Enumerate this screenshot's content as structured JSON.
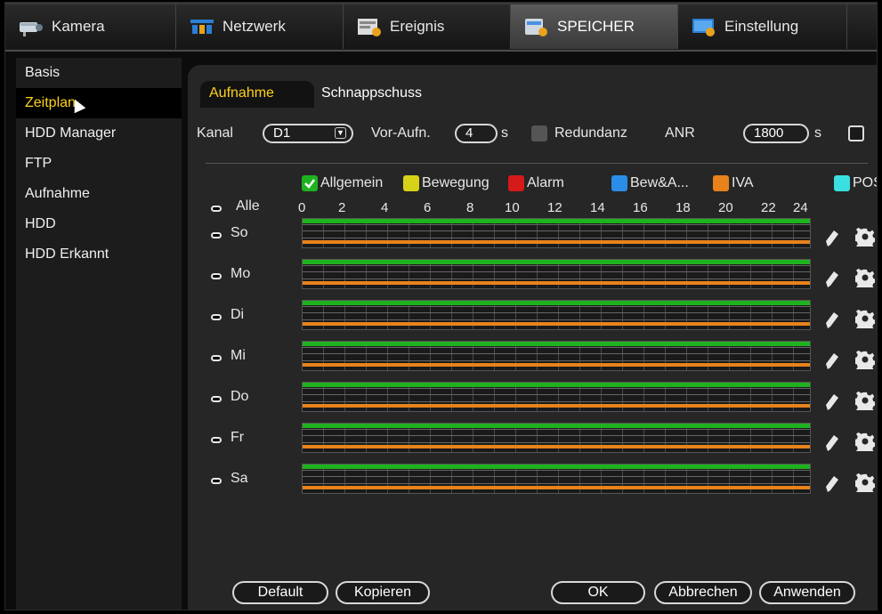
{
  "top_tabs": [
    {
      "label": "Kamera",
      "icon": "camera-icon"
    },
    {
      "label": "Netzwerk",
      "icon": "network-icon"
    },
    {
      "label": "Ereignis",
      "icon": "event-icon"
    },
    {
      "label": "SPEICHER",
      "icon": "storage-icon"
    },
    {
      "label": "Einstellung",
      "icon": "settings-monitor-icon"
    }
  ],
  "active_top_tab": "SPEICHER",
  "sidebar": {
    "items": [
      {
        "label": "Basis"
      },
      {
        "label": "Zeitplan"
      },
      {
        "label": "HDD Manager"
      },
      {
        "label": "FTP"
      },
      {
        "label": "Aufnahme"
      },
      {
        "label": "HDD"
      },
      {
        "label": "HDD Erkannt"
      }
    ],
    "active": "Zeitplan"
  },
  "sub_tabs": {
    "aufnahme": "Aufnahme",
    "schnappschuss": "Schnappschuss"
  },
  "settings": {
    "kanal_label": "Kanal",
    "kanal_value": "D1",
    "vor_label": "Vor-Aufn.",
    "vor_value": "4",
    "vor_unit": "s",
    "redundanz_label": "Redundanz",
    "anr_label": "ANR",
    "anr_value": "1800",
    "anr_unit": "s"
  },
  "legend": [
    {
      "label": "Allgemein",
      "color": "#1fb21f"
    },
    {
      "label": "Bewegung",
      "color": "#d6d21a"
    },
    {
      "label": "Alarm",
      "color": "#d61a1a"
    },
    {
      "label": "Bew&A...",
      "color": "#2a8ee8"
    },
    {
      "label": "IVA",
      "color": "#e8831c"
    },
    {
      "label": "POS",
      "color": "#3ae0e0"
    }
  ],
  "schedule": {
    "all_label": "Alle",
    "hours": [
      "0",
      "2",
      "4",
      "6",
      "8",
      "10",
      "12",
      "14",
      "16",
      "18",
      "20",
      "22",
      "24"
    ],
    "days": [
      {
        "label": "So"
      },
      {
        "label": "Mo"
      },
      {
        "label": "Di"
      },
      {
        "label": "Mi"
      },
      {
        "label": "Do"
      },
      {
        "label": "Fr"
      },
      {
        "label": "Sa"
      }
    ]
  },
  "buttons": {
    "default": "Default",
    "kopieren": "Kopieren",
    "ok": "OK",
    "abbrechen": "Abbrechen",
    "anwenden": "Anwenden"
  }
}
